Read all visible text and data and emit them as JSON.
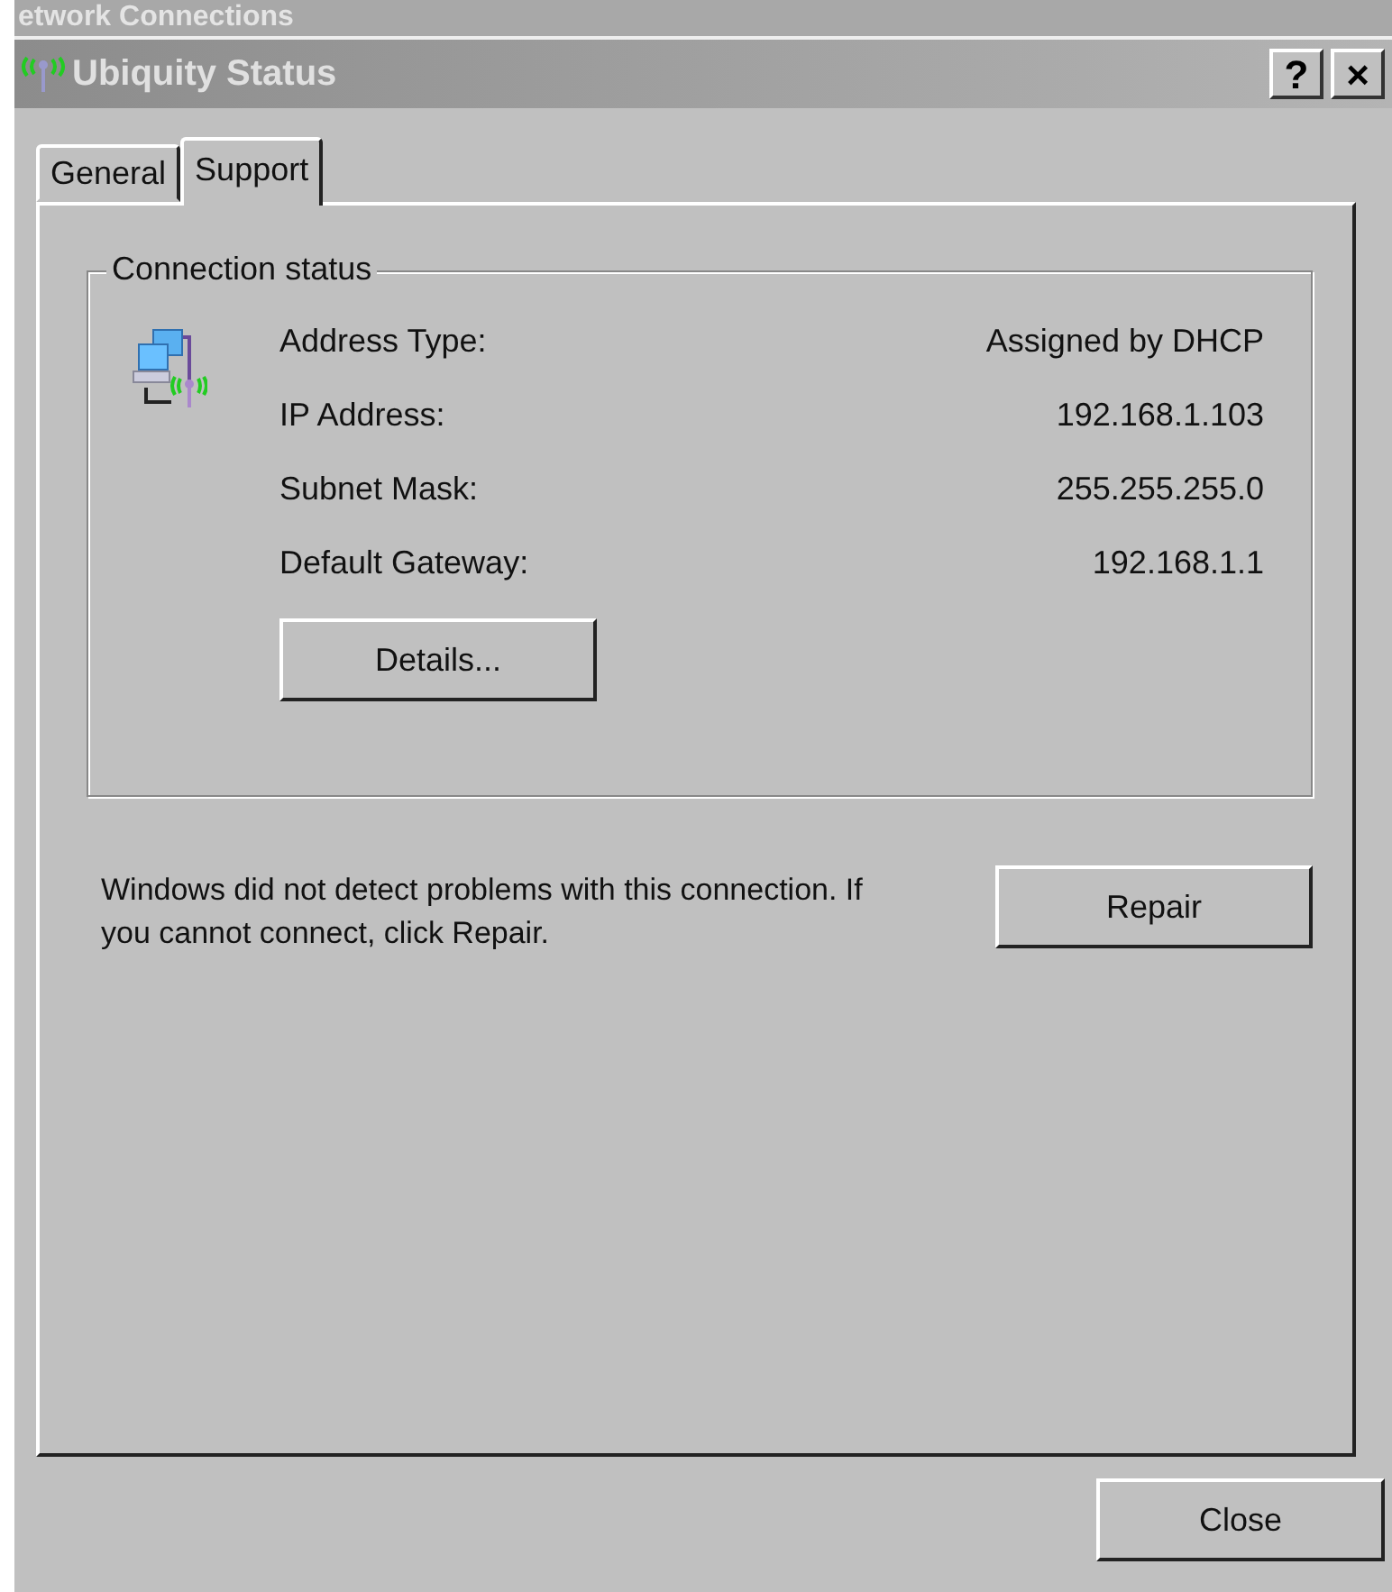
{
  "background_window": {
    "title": "etwork Connections"
  },
  "window": {
    "title": "Ubiquity Status",
    "buttons": [
      "?",
      "×"
    ]
  },
  "tabs": [
    {
      "label": "General",
      "selected": false
    },
    {
      "label": "Support",
      "selected": true
    }
  ],
  "connection_status": {
    "title": "Connection status",
    "rows": [
      {
        "label": "Address Type:",
        "value": "Assigned by DHCP"
      },
      {
        "label": "IP Address:",
        "value": "192.168.1.103"
      },
      {
        "label": "Subnet Mask:",
        "value": "255.255.255.0"
      },
      {
        "label": "Default Gateway:",
        "value": "192.168.1.1"
      }
    ],
    "details_button": "Details..."
  },
  "message": "Windows did not detect problems with this connection. If you cannot connect, click Repair.",
  "repair_button": "Repair",
  "close_button": "Close"
}
